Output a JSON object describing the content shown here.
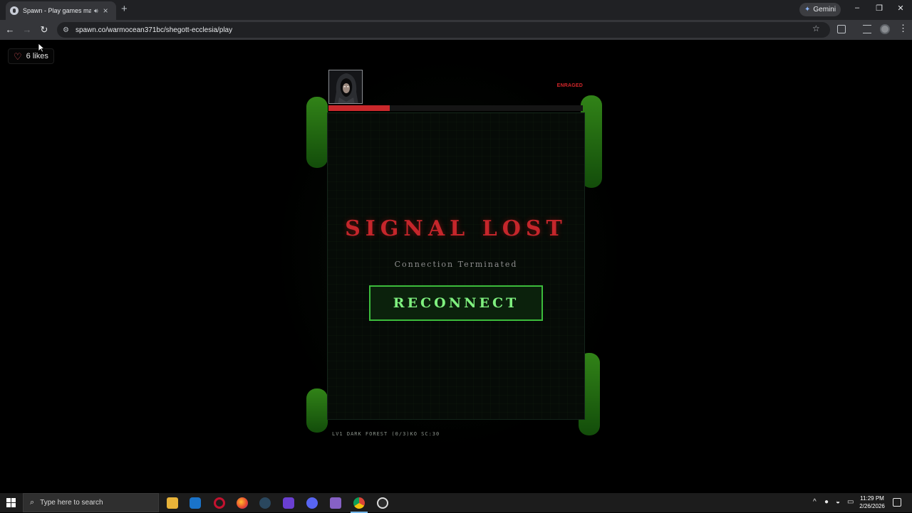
{
  "browser": {
    "tab_title": "Spawn - Play games made ...",
    "audio_icon": "speaker-icon",
    "tab_close": "×",
    "new_tab": "+",
    "gemini_label": "Gemini",
    "url": "spawn.co/warmocean371bc/shegott-ecclesia/play",
    "window_minimize": "–",
    "window_restore": "❐",
    "window_close": "✕"
  },
  "page": {
    "likes_label": "6 likes"
  },
  "game": {
    "status_badge": "ENRAGED",
    "health_fraction": 0.24,
    "health_color": "#c9282b",
    "title": "SIGNAL LOST",
    "subtitle": "Connection Terminated",
    "button_label": "RECONNECT",
    "footer": "LV1 DARK FOREST (0/3)KO SC:30",
    "accent_red": "#c5262b",
    "accent_green": "#3cbc3c"
  },
  "taskbar": {
    "search_placeholder": "Type here to search",
    "time": "11:29 PM",
    "date": "2/26/2026",
    "apps": [
      "file-explorer-icon",
      "outlook-icon",
      "opera-icon",
      "firefox-icon",
      "steam-icon",
      "vs-purple-icon",
      "discord-icon",
      "visual-studio-icon",
      "chrome-icon",
      "obs-icon"
    ]
  }
}
